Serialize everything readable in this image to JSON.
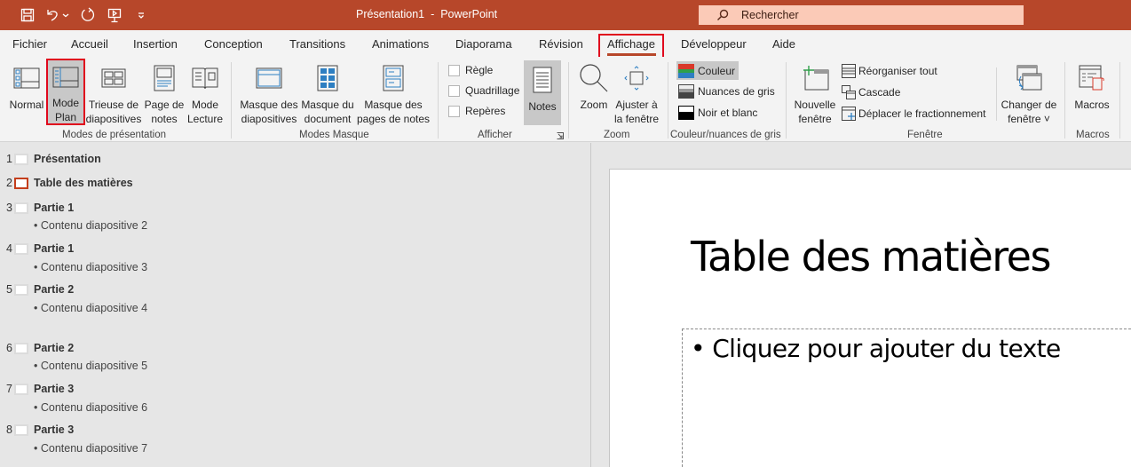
{
  "titlebar": {
    "window_title": "Présentation1  -  PowerPoint",
    "quick_access": [
      {
        "name": "save",
        "icon": "save-icon"
      },
      {
        "name": "undo",
        "icon": "undo-icon"
      },
      {
        "name": "redo",
        "icon": "redo-icon"
      },
      {
        "name": "start-presentation",
        "icon": "presentation-icon"
      },
      {
        "name": "customize",
        "icon": "customize-icon"
      }
    ],
    "search_placeholder": "Rechercher"
  },
  "tabs": [
    {
      "label": "Fichier"
    },
    {
      "label": "Accueil"
    },
    {
      "label": "Insertion"
    },
    {
      "label": "Conception"
    },
    {
      "label": "Transitions"
    },
    {
      "label": "Animations"
    },
    {
      "label": "Diaporama"
    },
    {
      "label": "Révision"
    },
    {
      "label": "Affichage",
      "active": true
    },
    {
      "label": "Développeur"
    },
    {
      "label": "Aide"
    }
  ],
  "ribbon": {
    "groups": {
      "presentation_modes": {
        "label": "Modes de présentation",
        "buttons": [
          {
            "label": "Normal"
          },
          {
            "label": "Mode\nPlan",
            "selected": true
          },
          {
            "label": "Trieuse de\ndiapositives"
          },
          {
            "label": "Page de\nnotes"
          },
          {
            "label": "Mode\nLecture"
          }
        ]
      },
      "master_modes": {
        "label": "Modes Masque",
        "buttons": [
          {
            "label": "Masque des\ndiapositives"
          },
          {
            "label": "Masque du\ndocument"
          },
          {
            "label": "Masque des\npages de notes"
          }
        ]
      },
      "show": {
        "label": "Afficher",
        "checkboxes": [
          {
            "label": "Règle",
            "checked": false
          },
          {
            "label": "Quadrillage",
            "checked": false
          },
          {
            "label": "Repères",
            "checked": false
          }
        ],
        "notes_label": "Notes"
      },
      "zoom": {
        "label": "Zoom",
        "buttons": [
          {
            "label": "Zoom"
          },
          {
            "label": "Ajuster à\nla fenêtre"
          }
        ]
      },
      "color": {
        "label": "Couleur/nuances de gris",
        "options": [
          {
            "label": "Couleur",
            "selected": true
          },
          {
            "label": "Nuances de gris"
          },
          {
            "label": "Noir et blanc"
          }
        ]
      },
      "window": {
        "label": "Fenêtre",
        "new_window": "Nouvelle\nfenêtre",
        "small": [
          {
            "label": "Réorganiser tout"
          },
          {
            "label": "Cascade"
          },
          {
            "label": "Déplacer le fractionnement"
          }
        ],
        "switch_window": "Changer de\nfenêtre ˅"
      },
      "macros": {
        "label": "Macros",
        "button": "Macros"
      }
    }
  },
  "outline": {
    "slides": [
      {
        "number": "1",
        "title": "Présentation",
        "bullets": []
      },
      {
        "number": "2",
        "title": "Table des matières",
        "bullets": [],
        "active": true
      },
      {
        "number": "3",
        "title": "Partie 1",
        "bullets": [
          "• Contenu diapositive 2"
        ]
      },
      {
        "number": "4",
        "title": "Partie 1",
        "bullets": [
          "• Contenu diapositive 3"
        ]
      },
      {
        "number": "5",
        "title": "Partie 2",
        "bullets": [
          "• Contenu diapositive 4"
        ]
      },
      {
        "number": "6",
        "title": "Partie 2",
        "bullets": [
          "• Contenu diapositive 5"
        ]
      },
      {
        "number": "7",
        "title": "Partie 3",
        "bullets": [
          "• Contenu diapositive 6"
        ]
      },
      {
        "number": "8",
        "title": "Partie 3",
        "bullets": [
          "• Contenu diapositive 7"
        ]
      }
    ]
  },
  "slide": {
    "title": "Table des matières",
    "content_placeholder": "• Cliquez pour ajouter du texte"
  },
  "colors": {
    "brand": "#b7472a",
    "search_bg": "#fbcab7",
    "highlight": "#e0081d"
  }
}
